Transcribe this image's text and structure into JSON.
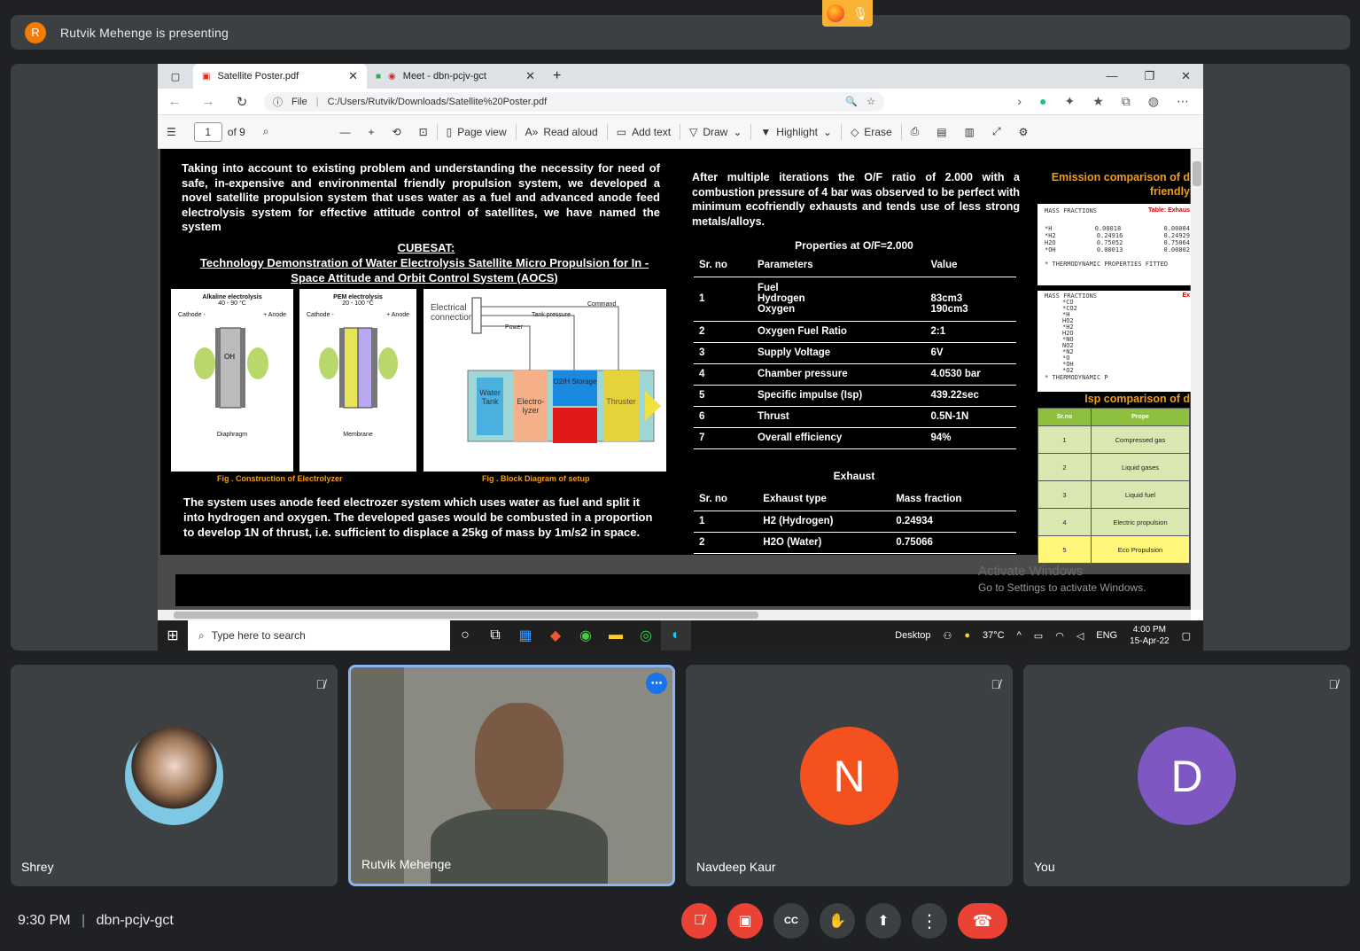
{
  "meet": {
    "presenter_banner": "Rutvik Mehenge is presenting",
    "presenter_initial": "R",
    "time": "9:30 PM",
    "divider": "|",
    "meeting_code": "dbn-pcjv-gct",
    "participants": [
      {
        "name": "Shrey"
      },
      {
        "name": "Rutvik Mehenge"
      },
      {
        "name": "Navdeep Kaur",
        "initial": "N",
        "color": "#f4511e"
      },
      {
        "name": "You",
        "initial": "D",
        "color": "#7e57c2"
      }
    ]
  },
  "browser": {
    "tabs": [
      {
        "label": "Satellite Poster.pdf"
      },
      {
        "label": "Meet - dbn-pcjv-gct"
      }
    ],
    "url_prefix": "File",
    "url": "C:/Users/Rutvik/Downloads/Satellite%20Poster.pdf",
    "pdf_toolbar": {
      "page": "1",
      "of_pages": "of 9",
      "page_view": "Page view",
      "read_aloud": "Read aloud",
      "add_text": "Add text",
      "draw": "Draw",
      "highlight": "Highlight",
      "erase": "Erase"
    }
  },
  "poster": {
    "intro": "Taking into account to existing problem and understanding the necessity for need of safe, in-expensive and environmental friendly propulsion system, we developed a novel satellite propulsion system that uses water as a fuel and advanced anode feed electrolysis system for effective attitude control of satellites, we have named the system",
    "cubesat": "CUBESAT:",
    "tech_demo": "Technology Demonstration of Water Electrolysis Satellite Micro Propulsion for In -Space Attitude and Orbit Control System (AOCS)",
    "fig1_caption": "Fig . Construction of Electrolyzer",
    "fig2_caption": "Fig . Block Diagram of setup",
    "fig_alkaline": "Alkaline electrolysis",
    "fig_alkaline_temp": "40 - 90 °C",
    "fig_pem": "PEM electrolysis",
    "fig_pem_temp": "20 - 100 °C",
    "fig_cathode": "Cathode -",
    "fig_anode": "+ Anode",
    "fig_diaphragm": "Diaphragm",
    "fig_membrane": "Membrane",
    "block_electrical": "Electrical connection",
    "block_command": "Command",
    "block_tank_pressure": "Tank pressure",
    "block_power": "Power",
    "block_water_tank": "Water Tank",
    "block_electrolyzer": "Electro-lyzer",
    "block_storage": "O2/H Storage",
    "block_thruster": "Thruster",
    "bottom": "The system uses anode feed electrozer system which uses water as fuel and split it into hydrogen and oxygen. The developed gases would be combusted in a proportion to develop 1N of thrust, i.e. sufficient to displace a 25kg of mass by 1m/s2 in space.",
    "right_intro": "After multiple iterations the O/F ratio of 2.000 with a combustion pressure of 4 bar was observed to be perfect with minimum ecofriendly exhausts and tends use of less strong metals/alloys.",
    "props_title": "Properties at O/F=2.000",
    "props_headers": [
      "Sr. no",
      "Parameters",
      "Value"
    ],
    "props_rows": [
      [
        "1",
        "Fuel\nHydrogen\nOxygen",
        "\n83cm3\n190cm3"
      ],
      [
        "2",
        "Oxygen Fuel Ratio",
        "2:1"
      ],
      [
        "3",
        "Supply Voltage",
        "6V"
      ],
      [
        "4",
        "Chamber pressure",
        "4.0530 bar"
      ],
      [
        "5",
        "Specific impulse (Isp)",
        "439.22sec"
      ],
      [
        "6",
        "Thrust",
        "0.5N-1N"
      ],
      [
        "7",
        "Overall efficiency",
        "94%"
      ]
    ],
    "exhaust_title": "Exhaust",
    "exhaust_headers": [
      "Sr. no",
      "Exhaust type",
      "Mass fraction"
    ],
    "exhaust_rows": [
      [
        "1",
        "H2 (Hydrogen)",
        "0.24934"
      ],
      [
        "2",
        "H2O (Water)",
        "0.75066"
      ]
    ],
    "emission_title": "Emission comparison of d friendly",
    "mass_fractions": "MASS FRACTIONS",
    "table_label": "Table: Exhaus",
    "mf_rows": [
      [
        "*H",
        "0.00018",
        "0.00004"
      ],
      [
        "*H2",
        "0.24916",
        "0.24929"
      ],
      [
        "H2O",
        "0.75052",
        "0.75064"
      ],
      [
        "*OH",
        "0.00013",
        "0.00002"
      ]
    ],
    "thermo_note": "* THERMODYNAMIC PROPERTIES FITTED",
    "mass_fractions2": "MASS FRACTIONS",
    "ex_label": "Ex",
    "species": [
      "*CO",
      "*CO2",
      "*H",
      "HO2",
      "*H2",
      "H2O",
      "*NO",
      "NO2",
      "*N2",
      "*O",
      "*OH",
      "*O2"
    ],
    "thermo_note2": "* THERMODYNAMIC P",
    "isp_title": "Isp comparison of d",
    "isp_headers": [
      "Sr.no",
      "Prope"
    ],
    "isp_rows": [
      [
        "1",
        "Compressed gas"
      ],
      [
        "2",
        "Liquid gases"
      ],
      [
        "3",
        "Liquid fuel"
      ],
      [
        "4",
        "Electric propulsion"
      ],
      [
        "5",
        "Eco Propulsion"
      ]
    ]
  },
  "windows": {
    "activate_title": "Activate Windows",
    "activate_sub": "Go to Settings to activate Windows.",
    "search_placeholder": "Type here to search",
    "desktop": "Desktop",
    "weather": "37°C",
    "lang": "ENG",
    "time": "4:00 PM",
    "date": "15-Apr-22"
  }
}
